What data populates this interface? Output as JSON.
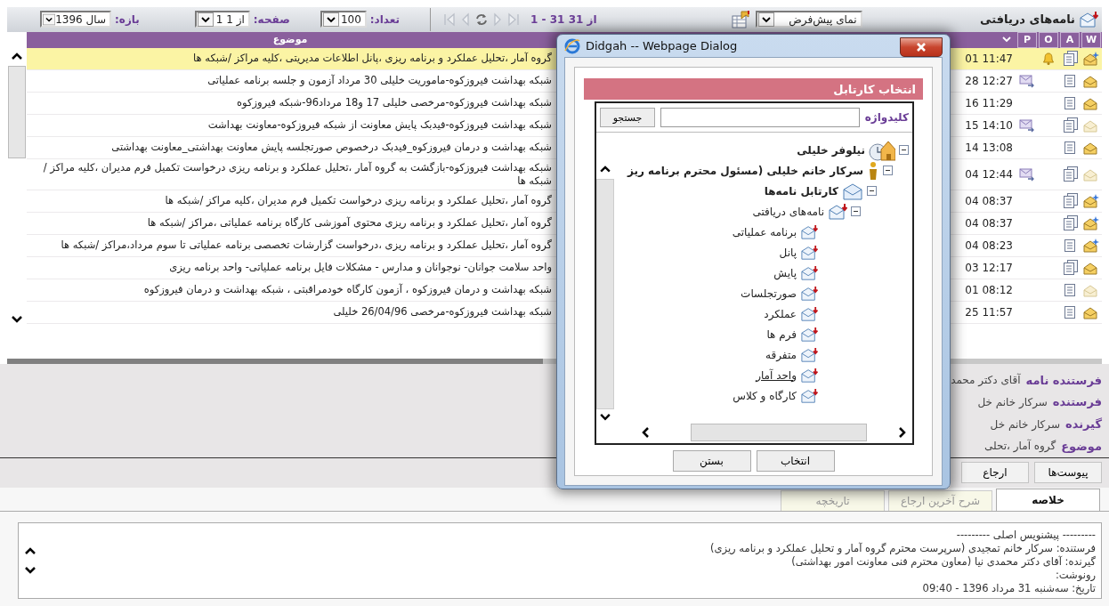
{
  "toolbar": {
    "title": "نامه‌های دریافتی",
    "view": {
      "value": "نمای پیش‌فرض"
    },
    "range_text": "1 - 31 از 31",
    "count": {
      "label": "تعداد:",
      "value": "100"
    },
    "page": {
      "label": "صفحه:",
      "value": "1 از 1"
    },
    "period": {
      "label": "بازه:",
      "value": "سال 1396"
    }
  },
  "table": {
    "columns": [
      {
        "label": "W"
      },
      {
        "label": "A"
      },
      {
        "label": "O"
      },
      {
        "label": "P"
      },
      {
        "label": "موضوع"
      }
    ],
    "rows": [
      {
        "subject": "گروه آمار ،تحلیل عملکرد و برنامه ریزی ،پانل اطلاعات مدیریتی ،کلیه مراکز /شبکه ها",
        "time": "01 11:47",
        "selected": true,
        "new": true,
        "faded": false,
        "multi_page": true,
        "reminder": true,
        "forwarded": false
      },
      {
        "subject": "شبکه بهداشت فیروزکوه-ماموریت خلیلی 30 مرداد آزمون و جلسه برنامه عملیاتی",
        "time": "28 12:27",
        "selected": false,
        "new": false,
        "faded": false,
        "multi_page": false,
        "reminder": false,
        "forwarded": true
      },
      {
        "subject": "شبکه بهداشت فیروزکوه-مرخصی خلیلی 17 و18 مرداد96-شبکه فیروزکوه",
        "time": "16 11:29",
        "selected": false,
        "new": false,
        "faded": false,
        "multi_page": false,
        "reminder": false,
        "forwarded": false
      },
      {
        "subject": "شبکه بهداشت فیروزکوه-فیدبک پایش معاونت از شبکه فیروزکوه-معاونت بهداشت",
        "time": "15 14:10",
        "selected": false,
        "new": false,
        "faded": true,
        "multi_page": true,
        "reminder": false,
        "forwarded": true
      },
      {
        "subject": "شبکه بهداشت و درمان فیروزکوه_فیدبک درخصوص صورتجلسه پایش معاونت بهداشتی_معاونت بهداشتی",
        "time": "14 13:08",
        "selected": false,
        "new": false,
        "faded": false,
        "multi_page": false,
        "reminder": false,
        "forwarded": false
      },
      {
        "subject": "شبکه بهداشت فیروزکوه-بازگشت به گروه آمار ،تحلیل عملکرد و برنامه ریزی درخواست تکمیل فرم مدیران ،کلیه مراکز /شبکه ها",
        "time": "04 12:44",
        "selected": false,
        "new": false,
        "faded": true,
        "multi_page": true,
        "reminder": false,
        "forwarded": true
      },
      {
        "subject": "گروه آمار ،تحلیل عملکرد و برنامه ریزی درخواست تکمیل فرم مدیران ،کلیه مراکز /شبکه ها",
        "time": "04 08:37",
        "selected": false,
        "new": true,
        "faded": false,
        "multi_page": true,
        "reminder": false,
        "forwarded": false
      },
      {
        "subject": "گروه آمار ،تحلیل عملکرد و برنامه ریزی محتوی آموزشی کارگاه برنامه عملیاتی ،مراکز /شبکه ها",
        "time": "04 08:37",
        "selected": false,
        "new": true,
        "faded": false,
        "multi_page": true,
        "reminder": false,
        "forwarded": false
      },
      {
        "subject": "گروه آمار ،تحلیل عملکرد و برنامه ریزی ،درخواست گزارشات تخصصی برنامه عملیاتی تا سوم مرداد،مراکز /شبکه ها",
        "time": "04 08:23",
        "selected": false,
        "new": true,
        "faded": false,
        "multi_page": false,
        "reminder": false,
        "forwarded": false
      },
      {
        "subject": "واحد سلامت جوانان- نوجوانان و مدارس - مشکلات فایل برنامه عملیاتی- واحد برنامه ریزی",
        "time": "03 12:17",
        "selected": false,
        "new": false,
        "faded": false,
        "multi_page": true,
        "reminder": false,
        "forwarded": false
      },
      {
        "subject": "شبکه بهداشت و درمان فیروزکوه ، آزمون کارگاه خودمراقبتی ، شبکه بهداشت و درمان فیروزکوه",
        "time": "01 08:12",
        "selected": false,
        "new": false,
        "faded": true,
        "multi_page": false,
        "reminder": false,
        "forwarded": false
      },
      {
        "subject": "شبکه بهداشت فیروزکوه-مرخصی 26/04/96 خلیلی",
        "time": "25 11:57",
        "selected": false,
        "new": false,
        "faded": false,
        "multi_page": false,
        "reminder": false,
        "forwarded": false
      }
    ]
  },
  "details": [
    {
      "label": "فرستنده نامه",
      "value": "آقای دکتر محمد"
    },
    {
      "label": "فرستنده",
      "value": "سرکار خانم خل"
    },
    {
      "label": "گیرنده",
      "value": "سرکار خانم خل"
    },
    {
      "label": "موضوع",
      "value": "گروه آمار ،تحلی"
    }
  ],
  "actions": [
    "پیوست‌ها",
    "ارجاع"
  ],
  "tabs": [
    {
      "label": "خلاصه",
      "selected": true
    },
    {
      "label": "شرح آخرین ارجاع",
      "selected": false
    },
    {
      "label": "تاریخچه",
      "selected": false
    }
  ],
  "summary": [
    "--------- پیشنویس اصلی ---------",
    "فرستنده: سرکار خانم تمجیدی (سرپرست محترم گروه آمار و تحلیل عملکرد و برنامه ریزی)",
    "گیرنده: آقای دکتر محمدی نیا (معاون محترم فنی معاونت امور بهداشتی)",
    "رونوشت:",
    "تاریخ: سه‌شنبه 31 مرداد 1396 - 09:40"
  ],
  "dialog": {
    "title": "Didgah -- Webpage Dialog",
    "heading": "انتخاب کارتابل",
    "search": {
      "label": "کلیدواژه",
      "button": "جستجو"
    },
    "tree": [
      {
        "label": "نیلوفر خلیلی",
        "kind": "home",
        "expanded": true,
        "selected": false,
        "children": [
          {
            "label": "سرکار خانم خلیلی (مسئول محترم برنامه ریز",
            "kind": "person",
            "expanded": true,
            "selected": false,
            "children": [
              {
                "label": "کارتابل نامه‌ها",
                "kind": "cartable",
                "expanded": true,
                "selected": false,
                "children": [
                  {
                    "label": "نامه‌های دریافتی",
                    "kind": "inbox",
                    "expanded": true,
                    "selected": false,
                    "children": [
                      {
                        "label": "برنامه عملیاتی",
                        "kind": "folder",
                        "selected": false
                      },
                      {
                        "label": "پانل",
                        "kind": "folder",
                        "selected": false
                      },
                      {
                        "label": "پایش",
                        "kind": "folder",
                        "selected": false
                      },
                      {
                        "label": "صورتجلسات",
                        "kind": "folder",
                        "selected": false
                      },
                      {
                        "label": "عملکرد",
                        "kind": "folder",
                        "selected": false
                      },
                      {
                        "label": "فرم ها",
                        "kind": "folder",
                        "selected": false
                      },
                      {
                        "label": "متفرقه",
                        "kind": "folder",
                        "selected": false
                      },
                      {
                        "label": "واحد آمار",
                        "kind": "folder",
                        "selected": true
                      },
                      {
                        "label": "کارگاه و کلاس",
                        "kind": "folder",
                        "selected": false
                      }
                    ]
                  }
                ]
              }
            ]
          }
        ]
      }
    ],
    "buttons": [
      "انتخاب",
      "بستن"
    ]
  }
}
